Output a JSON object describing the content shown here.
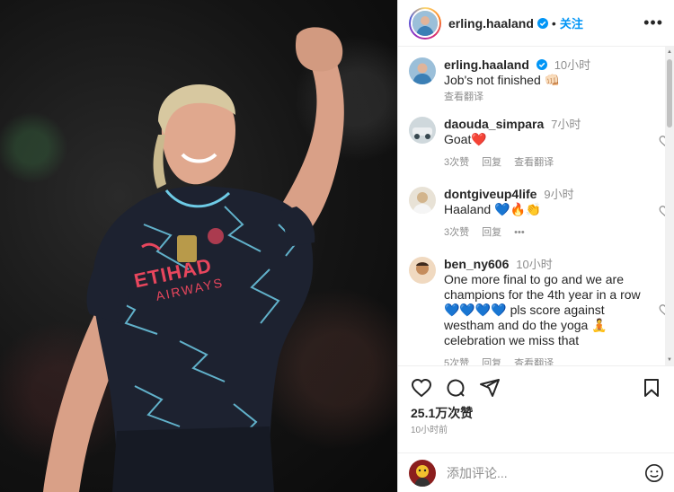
{
  "post": {
    "username": "erling.haaland",
    "follow_label": "关注",
    "more_label": "•••",
    "dot_sep": "•"
  },
  "caption": {
    "username": "erling.haaland",
    "time": "10小时",
    "text": "Job's not finished 👊🏻",
    "translate": "查看翻译"
  },
  "comments": [
    {
      "username": "daouda_simpara",
      "time": "7小时",
      "text": "Goat❤️",
      "likes": "3次赞",
      "reply": "回复",
      "translate": "查看翻译"
    },
    {
      "username": "dontgiveup4life",
      "time": "9小时",
      "text": "Haaland 💙🔥👏",
      "likes": "3次赞",
      "reply": "回复",
      "more": "•••"
    },
    {
      "username": "ben_ny606",
      "time": "10小时",
      "text": "One more final to go and we are champions for the 4th year in a row 💙💙💙💙 pls score against westham and do the yoga 🧘 celebration we miss that",
      "likes": "5次赞",
      "reply": "回复",
      "translate": "查看翻译"
    }
  ],
  "footer": {
    "likes": "25.1万次赞",
    "posted": "10小时前",
    "add_comment_placeholder": "添加评论..."
  },
  "photo": {
    "sponsor_line1": "ETIHAD",
    "sponsor_line2": "AIRWAYS"
  },
  "colors": {
    "accent": "#0095f6",
    "jersey": "#1d2230",
    "jersey_lines": "#6ecbe6",
    "sponsor": "#e8465d"
  }
}
